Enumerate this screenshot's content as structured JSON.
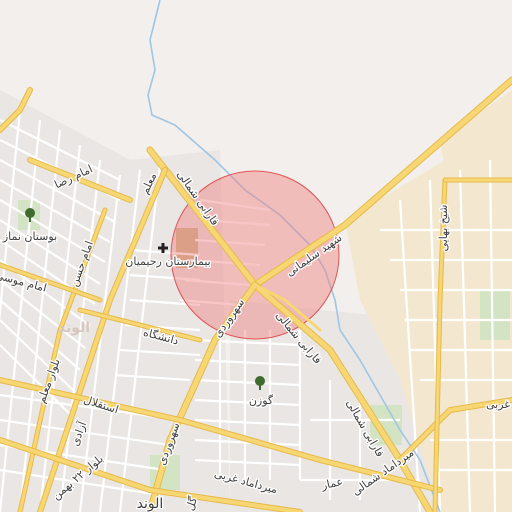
{
  "map": {
    "labels": {
      "imam_reza": "امام رضا",
      "boostan_namaz": "بوستان نماز",
      "imam_hasan": "امام حسن",
      "imam_mousa": "امام موسی",
      "moalem": "معلم",
      "farabi_shomali_north": "فارابی شمالی",
      "bimarestan": "بیمارستان رحیمیان",
      "shahid_soleimani": "شهید سلیمانی",
      "sohrevardi_north": "سهروردی",
      "farabi_shomali_south": "فارابی شمالی",
      "daneshgah": "دانشگاه",
      "alvand_district": "الوند",
      "bolvar_moalem": "بلوار معلم",
      "esteghlal": "استقلال",
      "azadi": "آزادی",
      "bolvar_22bahman": "بلوار ۲۲ بهمن",
      "sohrevardi_south": "سهروردی",
      "gozan": "گوزن",
      "meydan_gharbi": "میرداماد غربی",
      "meydan_shomali": "میرداماد شمالی",
      "ammar": "عمار",
      "farabi_east": "فارابی شمالی",
      "sheikh_bahaei": "شیخ بهایی",
      "gharbi_edge": "غربی",
      "alvand_town": "الوند",
      "golestan": "گل"
    },
    "icons": {
      "park_icon": "tree",
      "hospital_icon": "plus",
      "park2_icon": "tree"
    },
    "colors": {
      "land": "#f2efec",
      "urban": "#e9e6e3",
      "major_road": "#f7d774",
      "major_road_casing": "#e7b94a",
      "minor_road": "#ffffff",
      "river": "#9fc6e4",
      "park": "#d3e4c4",
      "highlight_fill": "#f08080",
      "highlight_stroke": "#e05656",
      "industrial": "#f4e7cf"
    }
  }
}
